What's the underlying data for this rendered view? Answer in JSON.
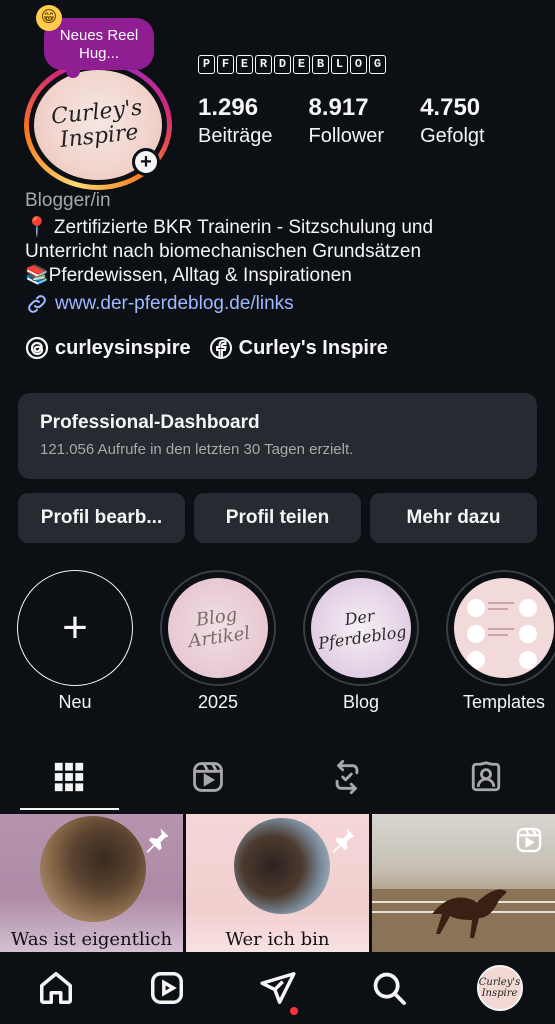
{
  "note": {
    "text": "Neues Reel Hug...",
    "emoji": "😁"
  },
  "profile": {
    "avatar_text": "Curley's Inspire",
    "username_chars": [
      "P",
      "F",
      "E",
      "R",
      "D",
      "E",
      "B",
      "L",
      "O",
      "G"
    ],
    "stats": [
      {
        "value": "1.296",
        "label": "Beiträge"
      },
      {
        "value": "8.917",
        "label": "Follower"
      },
      {
        "value": "4.750",
        "label": "Gefolgt"
      }
    ],
    "category": "Blogger/in",
    "bio_lines": [
      "📍 Zertifizierte BKR Trainerin - Sitzschulung und",
      "Unterricht nach biomechanischen Grundsätzen",
      "📚Pferdewissen, Alltag & Inspirationen"
    ],
    "link": "www.der-pferdeblog.de/links",
    "threads_handle": "curleysinspire",
    "facebook_name": "Curley's Inspire"
  },
  "dashboard": {
    "title": "Professional-Dashboard",
    "subtitle": "121.056 Aufrufe in den letzten 30 Tagen erzielt."
  },
  "actions": {
    "edit": "Profil bearb...",
    "share": "Profil teilen",
    "more": "Mehr dazu"
  },
  "highlights": [
    {
      "label": "Neu",
      "art": ""
    },
    {
      "label": "2025",
      "art": "Blog Artikel"
    },
    {
      "label": "Blog",
      "art": "Der Pferdeblog"
    },
    {
      "label": "Templates",
      "art": ""
    }
  ],
  "posts": [
    {
      "caption": "Was ist eigentlich"
    },
    {
      "caption": "Wer ich bin"
    },
    {
      "caption": ""
    }
  ],
  "nav": {
    "avatar_text": "Curley's Inspire"
  },
  "colors": {
    "background": "#0c1014",
    "card": "#262a31",
    "link": "#a0b8ff",
    "note_bubble": "#8e1e92",
    "notification_dot": "#ff3040"
  }
}
